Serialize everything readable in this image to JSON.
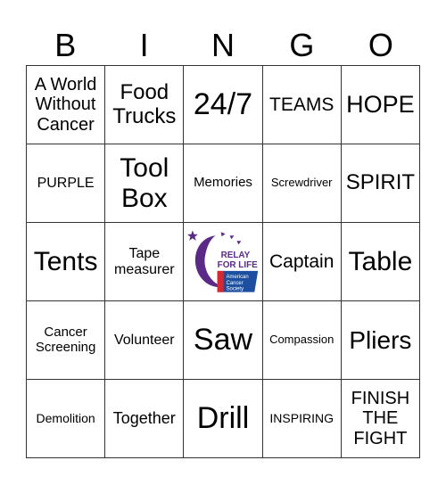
{
  "header": {
    "letters": [
      "B",
      "I",
      "N",
      "G",
      "O"
    ]
  },
  "cells": [
    {
      "text": "A World\nWithout\nCancer",
      "size": 20
    },
    {
      "text": "Food\nTrucks",
      "size": 24
    },
    {
      "text": "24/7",
      "size": 34
    },
    {
      "text": "TEAMS",
      "size": 21
    },
    {
      "text": "HOPE",
      "size": 27
    },
    {
      "text": "PURPLE",
      "size": 16
    },
    {
      "text": "Tool\nBox",
      "size": 30
    },
    {
      "text": "Memories",
      "size": 15
    },
    {
      "text": "Screwdriver",
      "size": 13
    },
    {
      "text": "SPIRIT",
      "size": 24
    },
    {
      "text": "Tents",
      "size": 30
    },
    {
      "text": "Tape\nmeasurer",
      "size": 16
    },
    {
      "text": "",
      "size": 0,
      "free": true,
      "logo": {
        "line1": "RELAY",
        "line2": "FOR LIFE",
        "org": [
          "American",
          "Cancer",
          "Society"
        ]
      }
    },
    {
      "text": "Captain",
      "size": 21
    },
    {
      "text": "Table",
      "size": 30
    },
    {
      "text": "Cancer\nScreening",
      "size": 15
    },
    {
      "text": "Volunteer",
      "size": 16
    },
    {
      "text": "Saw",
      "size": 34
    },
    {
      "text": "Compassion",
      "size": 13
    },
    {
      "text": "Pliers",
      "size": 28
    },
    {
      "text": "Demolition",
      "size": 14
    },
    {
      "text": "Together",
      "size": 18
    },
    {
      "text": "Drill",
      "size": 34
    },
    {
      "text": "INSPIRING",
      "size": 14
    },
    {
      "text": "FINISH\nTHE\nFIGHT",
      "size": 20
    }
  ],
  "colors": {
    "purple": "#5b2a86",
    "acs_blue": "#1c4fa0",
    "acs_red": "#d7282f"
  }
}
